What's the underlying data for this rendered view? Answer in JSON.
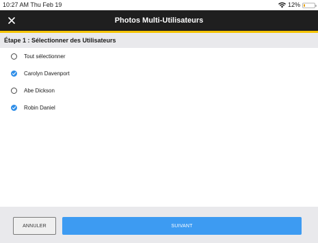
{
  "status_bar": {
    "time": "10:27 AM  Thu Feb 19",
    "battery_percent": "12%",
    "battery_level": 0.12,
    "wifi_icon": "wifi-icon",
    "battery_icon": "battery-icon"
  },
  "header": {
    "title": "Photos Multi-Utilisateurs",
    "close_icon": "close-icon",
    "background_color": "#1f1f1f",
    "accent_color": "#f5c400"
  },
  "section": {
    "title": "Étape 1 : Sélectionner des Utilisateurs"
  },
  "users": [
    {
      "label": "Tout sélectionner",
      "selected": false
    },
    {
      "label": "Carolyn Davenport",
      "selected": true
    },
    {
      "label": "Abe Dickson",
      "selected": false
    },
    {
      "label": "Robin Daniel",
      "selected": true
    }
  ],
  "footer": {
    "cancel_label": "ANNULER",
    "next_label": "SUIVANT",
    "next_color": "#3d9bf2"
  }
}
